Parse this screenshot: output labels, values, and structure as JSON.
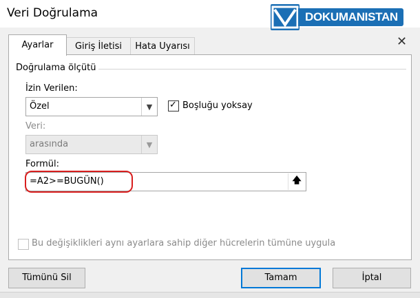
{
  "window": {
    "title": "Veri Doğrulama",
    "close_glyph": "✕"
  },
  "watermark": {
    "text": "DOKUMANISTAN",
    "brand_color": "#1b6fb5"
  },
  "tabs": [
    {
      "label": "Ayarlar",
      "active": true
    },
    {
      "label": "Giriş İletisi",
      "active": false
    },
    {
      "label": "Hata Uyarısı",
      "active": false
    }
  ],
  "settings": {
    "group_label": "Doğrulama ölçütü",
    "allow_label": "İzin Verilen:",
    "allow_value": "Özel",
    "ignore_blank_label": "Boşluğu yoksay",
    "ignore_blank_checked": true,
    "data_label": "Veri:",
    "data_value": "arasında",
    "formula_label": "Formül:",
    "formula_value": "=A2>=BUGÜN()",
    "apply_all_label": "Bu değişiklikleri aynı ayarlara sahip diğer hücrelerin tümüne uygula",
    "apply_all_checked": false
  },
  "buttons": {
    "clear_all": "Tümünü Sil",
    "ok": "Tamam",
    "cancel": "İptal"
  },
  "colors": {
    "highlight": "#d81e1e",
    "primary_border": "#0078d7"
  }
}
